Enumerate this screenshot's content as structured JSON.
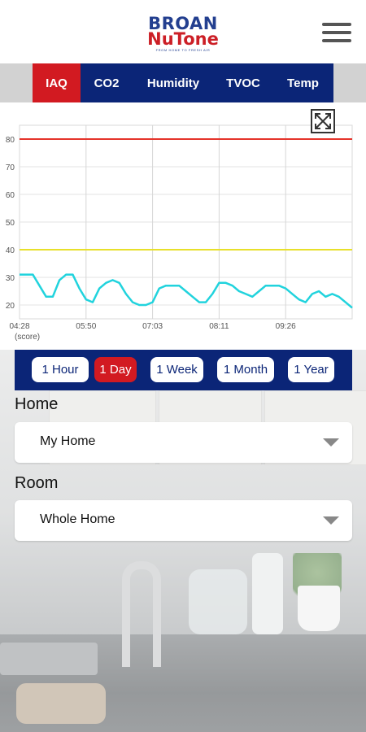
{
  "header": {
    "logo_top": "BROAN",
    "logo_bottom": "NuTone",
    "logo_tagline": "FROM HOME TO FRESH AIR"
  },
  "tabs": [
    {
      "label": "IAQ",
      "active": true
    },
    {
      "label": "CO2",
      "active": false
    },
    {
      "label": "Humidity",
      "active": false
    },
    {
      "label": "TVOC",
      "active": false
    },
    {
      "label": "Temp",
      "active": false
    }
  ],
  "chart_data": {
    "type": "line",
    "title": "",
    "xlabel": "",
    "ylabel": "(score)",
    "ylim": [
      15,
      85
    ],
    "yticks": [
      20,
      30,
      40,
      50,
      60,
      70,
      80
    ],
    "xticks": [
      "04:28",
      "05:50",
      "07:03",
      "08:11",
      "09:26"
    ],
    "reference_lines": [
      {
        "value": 80,
        "color": "#e5342b"
      },
      {
        "value": 40,
        "color": "#e8e02a"
      }
    ],
    "series": [
      {
        "color": "#21d3dd",
        "x": [
          0,
          2,
          4,
          6,
          8,
          10,
          12,
          14,
          16,
          18,
          20,
          22,
          24,
          26,
          28,
          30,
          32,
          34,
          36,
          38,
          40,
          42,
          44,
          46,
          48,
          50,
          52,
          54,
          56,
          58,
          60,
          62,
          64,
          66,
          68,
          70,
          72,
          74,
          76,
          78,
          80,
          82,
          84,
          86,
          88,
          90,
          92,
          94,
          96,
          98,
          100
        ],
        "y": [
          31,
          31,
          31,
          27,
          23,
          23,
          29,
          31,
          31,
          26,
          22,
          21,
          26,
          28,
          29,
          28,
          24,
          21,
          20,
          20,
          21,
          26,
          27,
          27,
          27,
          25,
          23,
          21,
          21,
          24,
          28,
          28,
          27,
          25,
          24,
          23,
          25,
          27,
          27,
          27,
          26,
          24,
          22,
          21,
          24,
          25,
          23,
          24,
          23,
          21,
          19
        ]
      }
    ]
  },
  "ranges": [
    {
      "label": "1 Hour",
      "active": false
    },
    {
      "label": "1 Day",
      "active": true
    },
    {
      "label": "1 Week",
      "active": false
    },
    {
      "label": "1 Month",
      "active": false
    },
    {
      "label": "1 Year",
      "active": false
    }
  ],
  "home": {
    "label": "Home",
    "value": "My Home"
  },
  "room": {
    "label": "Room",
    "value": "Whole Home"
  }
}
